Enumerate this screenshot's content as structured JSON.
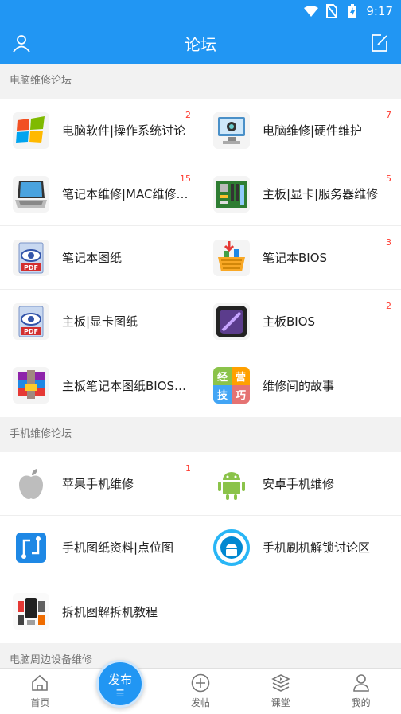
{
  "status": {
    "time": "9:17"
  },
  "header": {
    "title": "论坛"
  },
  "sections": [
    {
      "title": "电脑维修论坛",
      "rows": [
        [
          {
            "name": "电脑软件|操作系统讨论",
            "badge": "2",
            "icon": "windows-icon"
          },
          {
            "name": "电脑维修|硬件维护",
            "badge": "7",
            "icon": "computer-icon"
          }
        ],
        [
          {
            "name": "笔记本维修|MAC维修专区",
            "badge": "15",
            "icon": "laptop-icon"
          },
          {
            "name": "主板|显卡|服务器维修",
            "badge": "5",
            "icon": "motherboard-icon"
          }
        ],
        [
          {
            "name": "笔记本图纸",
            "badge": "",
            "icon": "pdf-icon"
          },
          {
            "name": "笔记本BIOS",
            "badge": "3",
            "icon": "basket-icon"
          }
        ],
        [
          {
            "name": "主板|显卡图纸",
            "badge": "",
            "icon": "pdf-icon"
          },
          {
            "name": "主板BIOS",
            "badge": "2",
            "icon": "chip-icon"
          }
        ],
        [
          {
            "name": "主板笔记本图纸BIOS下载",
            "badge": "",
            "icon": "archive-icon"
          },
          {
            "name": "维修间的故事",
            "badge": "",
            "icon": "story-tiles-icon"
          }
        ]
      ]
    },
    {
      "title": "手机维修论坛",
      "rows": [
        [
          {
            "name": "苹果手机维修",
            "badge": "1",
            "icon": "apple-icon"
          },
          {
            "name": "安卓手机维修",
            "badge": "",
            "icon": "android-icon"
          }
        ],
        [
          {
            "name": "手机图纸资料|点位图",
            "badge": "",
            "icon": "schematic-icon"
          },
          {
            "name": "手机刷机解锁讨论区",
            "badge": "",
            "icon": "unlock-android-icon"
          }
        ],
        [
          {
            "name": "拆机图解拆机教程",
            "badge": "",
            "icon": "teardown-icon"
          },
          null
        ]
      ]
    },
    {
      "title": "电脑周边设备维修",
      "rows": []
    }
  ],
  "story_tiles": [
    "经",
    "营",
    "技",
    "巧"
  ],
  "publish": {
    "label": "发布",
    "mark": "☰"
  },
  "tabs": [
    {
      "label": "首页",
      "icon": "home-icon"
    },
    {
      "label": "",
      "icon": "publish-spacer"
    },
    {
      "label": "发帖",
      "icon": "plus-circle-icon"
    },
    {
      "label": "课堂",
      "icon": "classroom-icon"
    },
    {
      "label": "我的",
      "icon": "profile-icon"
    }
  ],
  "colors": {
    "primary": "#2196f3",
    "badge": "#ff3b30"
  }
}
